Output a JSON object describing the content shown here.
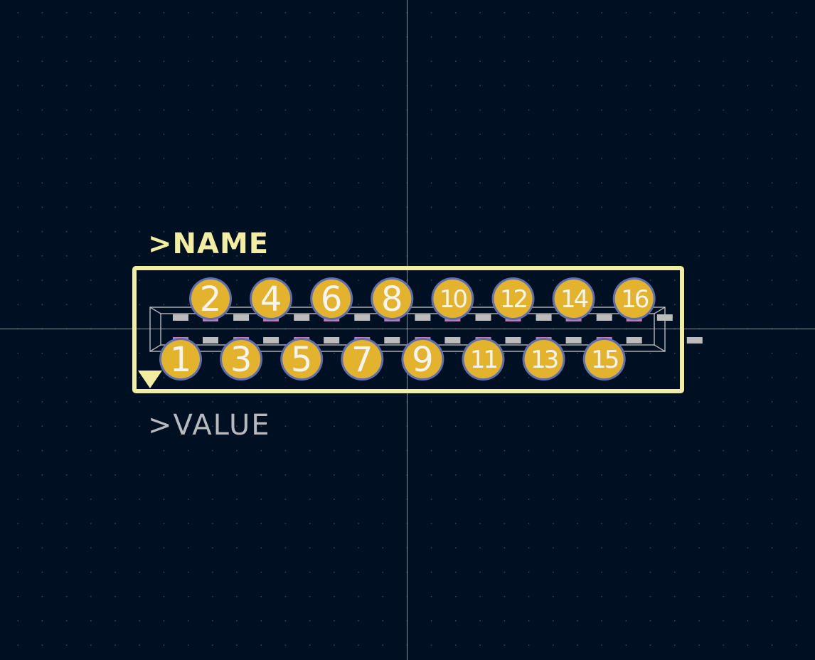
{
  "footprint": {
    "name_text": ">NAME",
    "value_text": ">VALUE",
    "pads_top": [
      "2",
      "4",
      "6",
      "8",
      "10",
      "12",
      "14",
      "16"
    ],
    "pads_bottom": [
      "1",
      "3",
      "5",
      "7",
      "9",
      "11",
      "13",
      "15"
    ]
  },
  "colors": {
    "background": "#001023",
    "grid_dot": "#3a4a5e",
    "crosshair": "#b4bcc6",
    "silkscreen": "#f2eda1",
    "fab_outline": "#c8c8c8",
    "pad_copper": "#e3b32d",
    "pad_ring": "#5c6fb4",
    "pad_number": "#f4f4f4",
    "contact_gray": "#bcbcbc",
    "contact_pink": "#c07ab8",
    "value_text": "#b7b9bd"
  },
  "icons": {
    "pin1_marker": "triangle-pin1-icon"
  }
}
